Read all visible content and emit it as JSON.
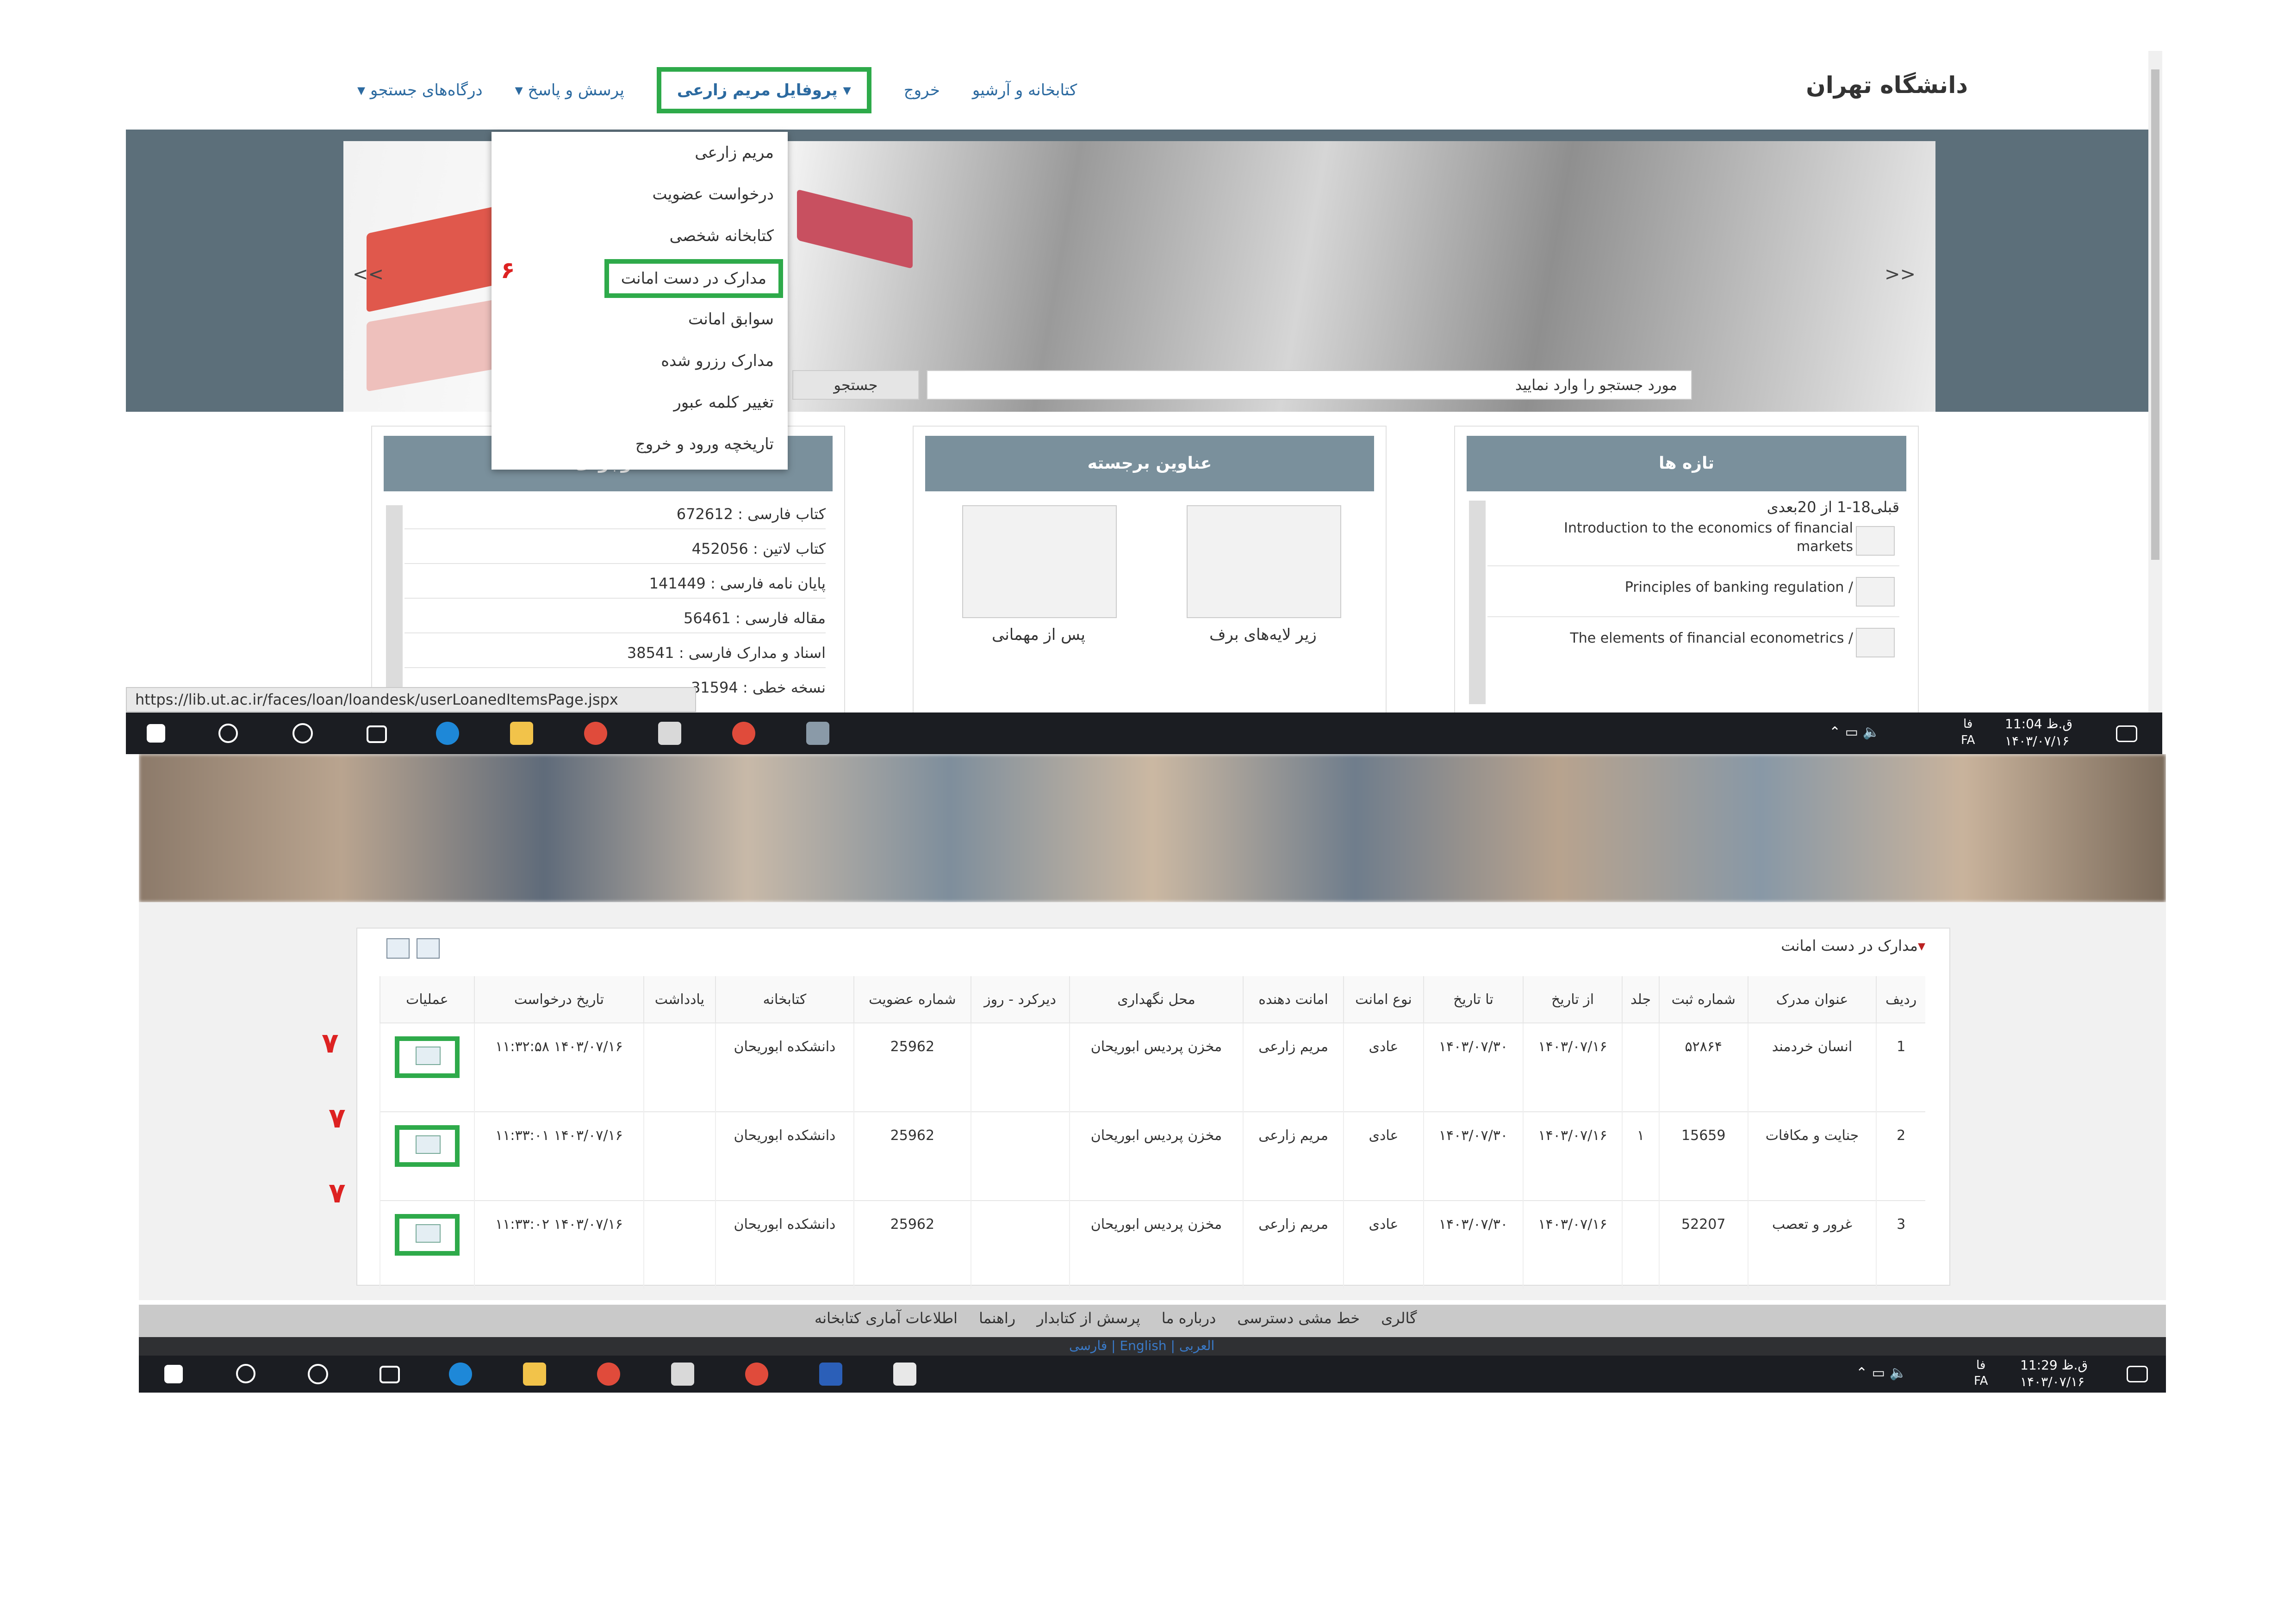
{
  "top": {
    "brand": "دانشگاه تهران",
    "nav": {
      "search": "درگاه‌های جستجو ▾",
      "qa": "پرسش و پاسخ ▾",
      "profile": "▾ پروفایل مریم زارعی",
      "exit": "خروج",
      "library": "کتابخانه و آرشیو"
    },
    "dropdown": [
      "مریم زارعی",
      "درخواست عضویت",
      "کتابخانه شخصی",
      "مدارک در دست امانت",
      "سوابق امانت",
      "مدارک رزرو شده",
      "تغییر کلمه عبور",
      "تاریخچه ورود و خروج"
    ],
    "step_badge": "۶",
    "search_placeholder": "مورد جستجو را وارد نمایید",
    "search_button": "جستجو",
    "arrow_prev": "<<",
    "arrow_next": ">>",
    "panel_new": {
      "title": "تازه ها",
      "pager": "قبلی18-1 از 20بعدی",
      "items": [
        "Introduction to the economics of financial markets",
        "/ Principles of banking regulation",
        "/ The elements of financial econometrics"
      ]
    },
    "panel_featured": {
      "title": "عناوین برجسته",
      "items": [
        "زیر لایه‌های برف",
        "پس از مهمانی"
      ]
    },
    "panel_stats": {
      "title": "موجودی",
      "items": [
        "کتاب فارسی : 672612",
        "کتاب لاتین : 452056",
        "پایان نامه فارسی : 141449",
        "مقاله فارسی : 56461",
        "اسناد و مدارک فارسی : 38541",
        "نسخه خطی : 31594"
      ]
    },
    "status_url": "https://lib.ut.ac.ir/faces/loan/loandesk/userLoanedItemsPage.jspx",
    "clock": {
      "time": "11:04 ق.ظ",
      "date": "۱۴۰۳/۰۷/۱۶",
      "lang": "فا",
      "lang2": "FA"
    }
  },
  "bottom": {
    "section_title": "مدارک در دست امانت",
    "headers": [
      "ردیف",
      "عنوان مدرک",
      "شماره ثبت",
      "جلد",
      "از تاریخ",
      "تا تاریخ",
      "نوع امانت",
      "امانت دهنده",
      "محل نگهداری",
      "دیرکرد - روز",
      "شماره عضویت",
      "کتابخانه",
      "یادداشت",
      "تاریخ درخواست",
      "عملیات"
    ],
    "rows": [
      {
        "n": "1",
        "title": "انسان خردمند",
        "reg": "۵۲۸۶۴",
        "vol": "",
        "from": "۱۴۰۳/۰۷/۱۶",
        "to": "۱۴۰۳/۰۷/۳۰",
        "type": "عادی",
        "lender": "مریم زارعی",
        "loc": "مخزن پردیس ابوریحان",
        "late": "",
        "member": "25962",
        "lib": "دانشکده ابوریحان",
        "note": "",
        "req": "۱۴۰۳/۰۷/۱۶ ۱۱:۳۲:۵۸"
      },
      {
        "n": "2",
        "title": "جنایت و مکافات",
        "reg": "15659",
        "vol": "۱",
        "from": "۱۴۰۳/۰۷/۱۶",
        "to": "۱۴۰۳/۰۷/۳۰",
        "type": "عادی",
        "lender": "مریم زارعی",
        "loc": "مخزن پردیس ابوریحان",
        "late": "",
        "member": "25962",
        "lib": "دانشکده ابوریحان",
        "note": "",
        "req": "۱۴۰۳/۰۷/۱۶ ۱۱:۳۳:۰۱"
      },
      {
        "n": "3",
        "title": "غرور و تعصب",
        "reg": "52207",
        "vol": "",
        "from": "۱۴۰۳/۰۷/۱۶",
        "to": "۱۴۰۳/۰۷/۳۰",
        "type": "عادی",
        "lender": "مریم زارعی",
        "loc": "مخزن پردیس ابوریحان",
        "late": "",
        "member": "25962",
        "lib": "دانشکده ابوریحان",
        "note": "",
        "req": "۱۴۰۳/۰۷/۱۶ ۱۱:۳۳:۰۲"
      }
    ],
    "step_badge": "۷",
    "footer_links": [
      "گالری",
      "خط مشی دسترسی",
      "درباره ما",
      "پرسش از کتابدار",
      "راهنما",
      "اطلاعات آماری کتابخانه"
    ],
    "footer_lang": "فارسی | English | العربی",
    "clock": {
      "time": "11:29 ق.ظ",
      "date": "۱۴۰۳/۰۷/۱۶",
      "lang": "فا",
      "lang2": "FA"
    }
  },
  "colors": {
    "highlight": "#2eaa4a",
    "badge": "#dd2222",
    "panel_header": "#7a909c",
    "link": "#2c6aa0"
  }
}
